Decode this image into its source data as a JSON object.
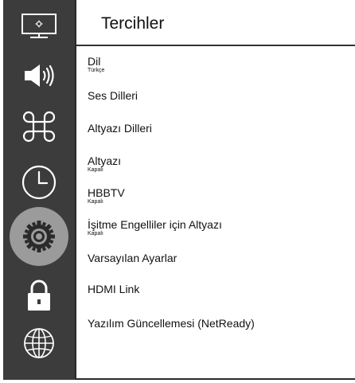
{
  "header": {
    "title": "Tercihler"
  },
  "sidebar": {
    "items": [
      {
        "id": "picture",
        "icon": "monitor-icon"
      },
      {
        "id": "sound",
        "icon": "speaker-icon"
      },
      {
        "id": "features",
        "icon": "command-icon"
      },
      {
        "id": "timer",
        "icon": "clock-icon"
      },
      {
        "id": "settings",
        "icon": "gear-icon",
        "active": true
      },
      {
        "id": "lock",
        "icon": "lock-icon"
      },
      {
        "id": "network",
        "icon": "globe-icon"
      }
    ]
  },
  "menu": {
    "items": [
      {
        "label": "Dil",
        "value": "Türkçe"
      },
      {
        "label": "Ses Dilleri"
      },
      {
        "label": "Altyazı Dilleri"
      },
      {
        "label": "Altyazı",
        "value": "Kapalı"
      },
      {
        "label": "HBBTV",
        "value": "Kapalı"
      },
      {
        "label": "İşitme Engelliler için Altyazı",
        "value": "Kapalı"
      },
      {
        "label": "Varsayılan Ayarlar"
      },
      {
        "label": "HDMI Link"
      },
      {
        "label": "Yazılım Güncellemesi (NetReady)"
      }
    ]
  },
  "colors": {
    "sidebar_bg": "#3c3c3c",
    "active_ring": "#9b9b9b",
    "icon": "#ffffff",
    "text": "#111111"
  }
}
